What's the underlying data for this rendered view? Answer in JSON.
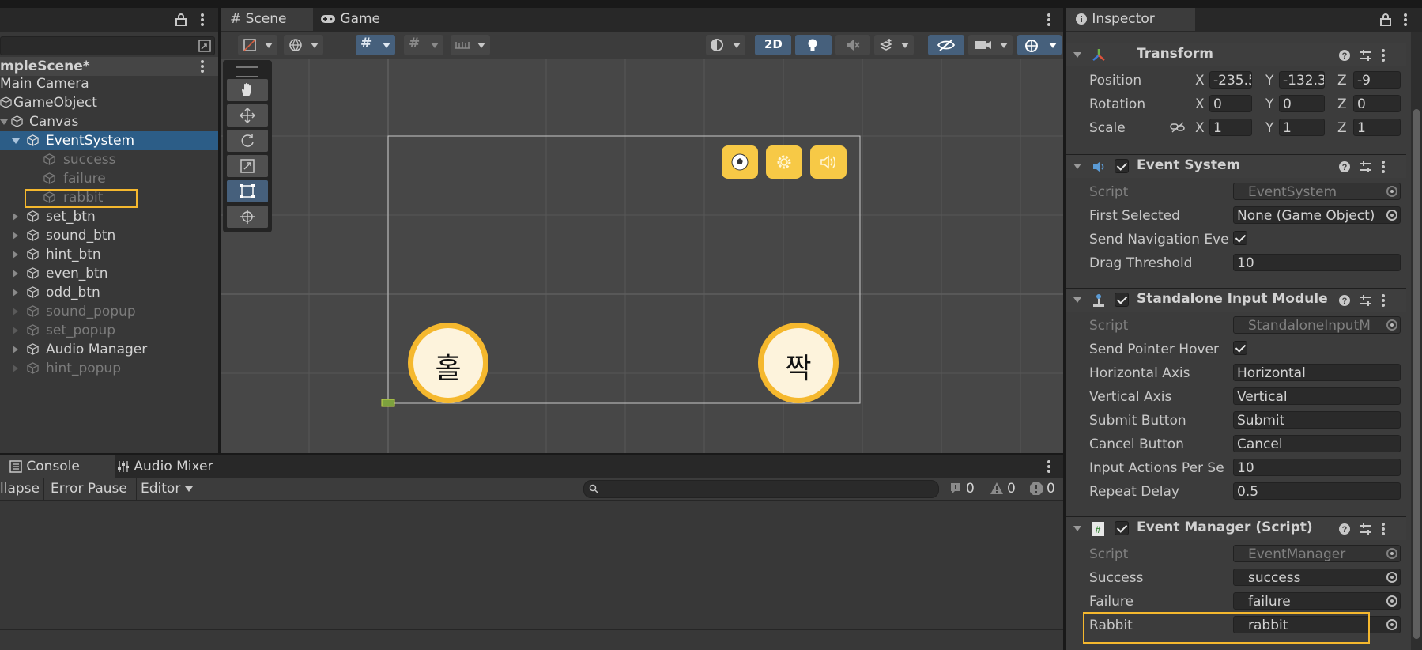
{
  "hierarchy": {
    "scene_name": "mpleScene*",
    "items": [
      {
        "label": "Main Camera"
      },
      {
        "label": "GameObject"
      },
      {
        "label": "Canvas"
      },
      {
        "label": "EventSystem"
      },
      {
        "label": "success"
      },
      {
        "label": "failure"
      },
      {
        "label": "rabbit"
      },
      {
        "label": "set_btn"
      },
      {
        "label": "sound_btn"
      },
      {
        "label": "hint_btn"
      },
      {
        "label": "even_btn"
      },
      {
        "label": "odd_btn"
      },
      {
        "label": "sound_popup"
      },
      {
        "label": "set_popup"
      },
      {
        "label": "Audio Manager"
      },
      {
        "label": "hint_popup"
      }
    ]
  },
  "scene": {
    "tabs": [
      {
        "label": "Scene"
      },
      {
        "label": "Game"
      }
    ],
    "mode_2d_label": "2D",
    "odd_button_text": "홀",
    "even_button_text": "짝"
  },
  "console": {
    "tabs": [
      {
        "label": "Console"
      },
      {
        "label": "Audio Mixer"
      }
    ],
    "collapse_label": "llapse",
    "error_pause_label": "Error Pause",
    "editor_label": "Editor",
    "counts": {
      "log": "0",
      "warning": "0",
      "error": "0"
    }
  },
  "inspector": {
    "tab_label": "Inspector",
    "transform": {
      "title": "Transform",
      "position_label": "Position",
      "rotation_label": "Rotation",
      "scale_label": "Scale",
      "x": "X",
      "y": "Y",
      "z": "Z",
      "position": {
        "x": "-235.5",
        "y": "-132.3",
        "z": "-9"
      },
      "rotation": {
        "x": "0",
        "y": "0",
        "z": "0"
      },
      "scale": {
        "x": "1",
        "y": "1",
        "z": "1"
      }
    },
    "event_system": {
      "title": "Event System",
      "script_label": "Script",
      "script_value": "EventSystem",
      "first_selected_label": "First Selected",
      "first_selected_value": "None (Game Object)",
      "send_nav_label": "Send Navigation Eve",
      "drag_threshold_label": "Drag Threshold",
      "drag_threshold_value": "10"
    },
    "standalone_input": {
      "title": "Standalone Input Module",
      "script_label": "Script",
      "script_value": "StandaloneInputM",
      "send_pointer_label": "Send Pointer Hover",
      "horizontal_label": "Horizontal Axis",
      "horizontal_value": "Horizontal",
      "vertical_label": "Vertical Axis",
      "vertical_value": "Vertical",
      "submit_label": "Submit Button",
      "submit_value": "Submit",
      "cancel_label": "Cancel Button",
      "cancel_value": "Cancel",
      "actions_label": "Input Actions Per Se",
      "actions_value": "10",
      "repeat_label": "Repeat Delay",
      "repeat_value": "0.5"
    },
    "event_manager": {
      "title": "Event Manager (Script)",
      "script_label": "Script",
      "script_value": "EventManager",
      "success_label": "Success",
      "success_value": "success",
      "failure_label": "Failure",
      "failure_value": "failure",
      "rabbit_label": "Rabbit",
      "rabbit_value": "rabbit"
    }
  },
  "colors": {
    "highlight": "#f5b82e",
    "selection": "#2c5d87",
    "button_yellow": "#f7c946"
  }
}
